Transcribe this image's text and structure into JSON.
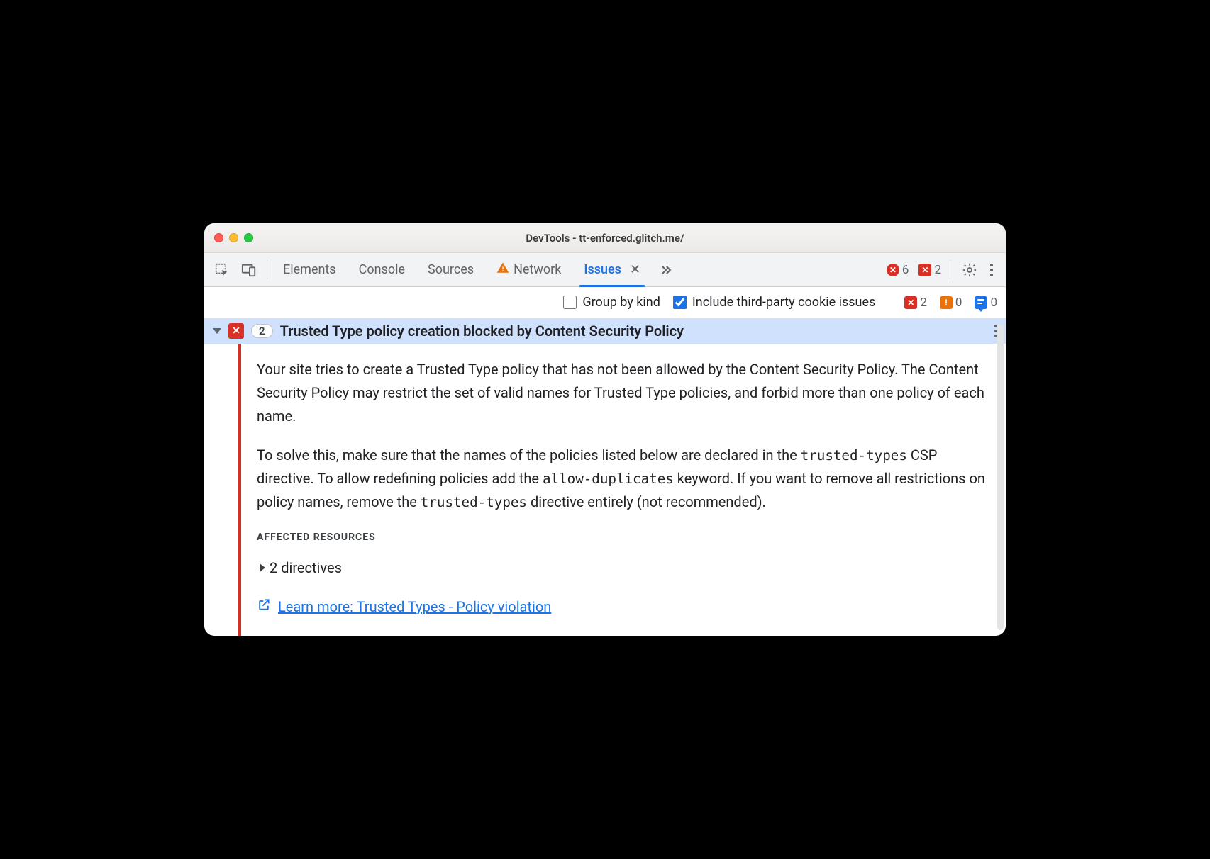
{
  "window": {
    "title": "DevTools - tt-enforced.glitch.me/"
  },
  "tabs": {
    "elements": "Elements",
    "console": "Console",
    "sources": "Sources",
    "network": "Network",
    "issues": "Issues"
  },
  "status": {
    "error_count": "6",
    "issue_error_count": "2"
  },
  "toolbar": {
    "group_by_kind": "Group by kind",
    "include_3p": "Include third-party cookie issues",
    "counts": {
      "errors": "2",
      "warnings": "0",
      "info": "0"
    }
  },
  "issue": {
    "count": "2",
    "title": "Trusted Type policy creation blocked by Content Security Policy",
    "p1a": "Your site tries to create a Trusted Type policy that has not been allowed by the Content Security Policy. The Content Security Policy may restrict the set of valid names for Trusted Type policies, and forbid more than one policy of each name.",
    "p2_pre": "To solve this, make sure that the names of the policies listed below are declared in the ",
    "p2_code1": "trusted-types",
    "p2_mid1": " CSP directive. To allow redefining policies add the ",
    "p2_code2": "allow-duplicates",
    "p2_mid2": " keyword. If you want to remove all restrictions on policy names, remove the ",
    "p2_code3": "trusted-types",
    "p2_post": " directive entirely (not recommended).",
    "affected_label": "AFFECTED RESOURCES",
    "directives_label": "2 directives",
    "learn_more": "Learn more: Trusted Types - Policy violation"
  }
}
